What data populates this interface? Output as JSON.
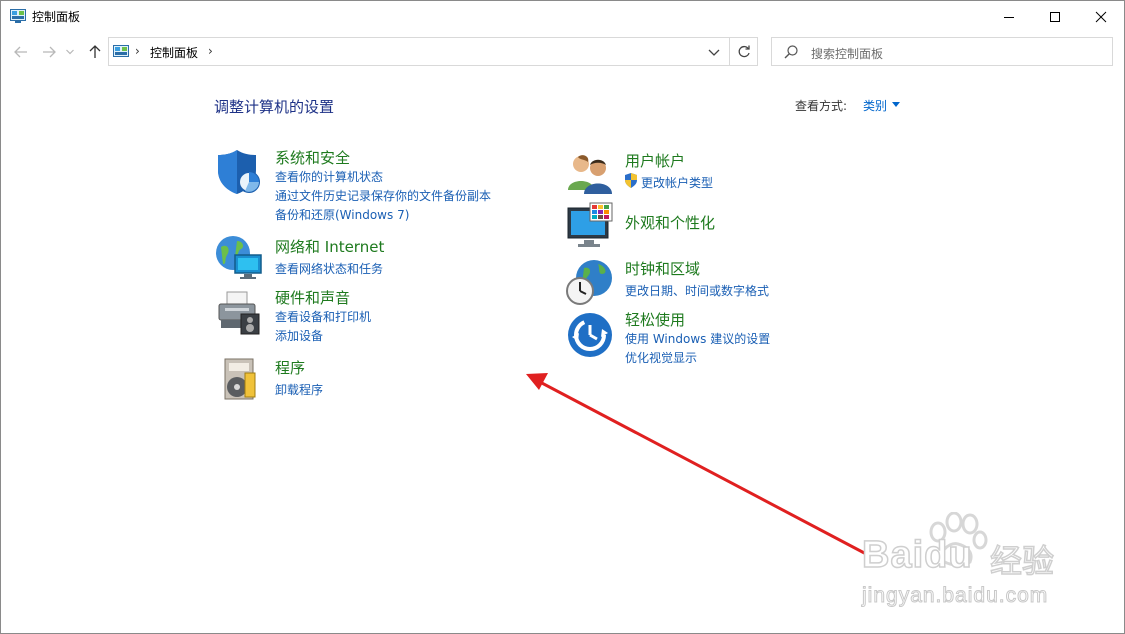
{
  "window": {
    "title": "控制面板"
  },
  "address": {
    "crumb": "控制面板"
  },
  "search": {
    "placeholder": "搜索控制面板"
  },
  "main": {
    "heading": "调整计算机的设置",
    "view_by_label": "查看方式:",
    "view_by_value": "类别"
  },
  "categories": [
    {
      "title": "系统和安全",
      "icon": "shield-icon",
      "links": [
        "查看你的计算机状态",
        "通过文件历史记录保存你的文件备份副本",
        "备份和还原(Windows 7)"
      ]
    },
    {
      "title": "网络和 Internet",
      "icon": "network-icon",
      "links": [
        "查看网络状态和任务"
      ]
    },
    {
      "title": "硬件和声音",
      "icon": "printer-icon",
      "links": [
        "查看设备和打印机",
        "添加设备"
      ]
    },
    {
      "title": "程序",
      "icon": "programs-icon",
      "links": [
        "卸载程序"
      ]
    },
    {
      "title": "用户帐户",
      "icon": "users-icon",
      "links": [
        "更改帐户类型"
      ]
    },
    {
      "title": "外观和个性化",
      "icon": "monitor-icon",
      "links": []
    },
    {
      "title": "时钟和区域",
      "icon": "clock-globe-icon",
      "links": [
        "更改日期、时间或数字格式"
      ]
    },
    {
      "title": "轻松使用",
      "icon": "accessibility-icon",
      "links": [
        "使用 Windows 建议的设置",
        "优化视觉显示"
      ]
    }
  ],
  "watermark": {
    "brand": "Baidu",
    "cn": "经验",
    "url": "jingyan.baidu.com"
  },
  "colors": {
    "title_link": "#1e3287",
    "category": "#1e7a1e",
    "link": "#1a5fb4",
    "annotation_arrow": "#e02020"
  }
}
